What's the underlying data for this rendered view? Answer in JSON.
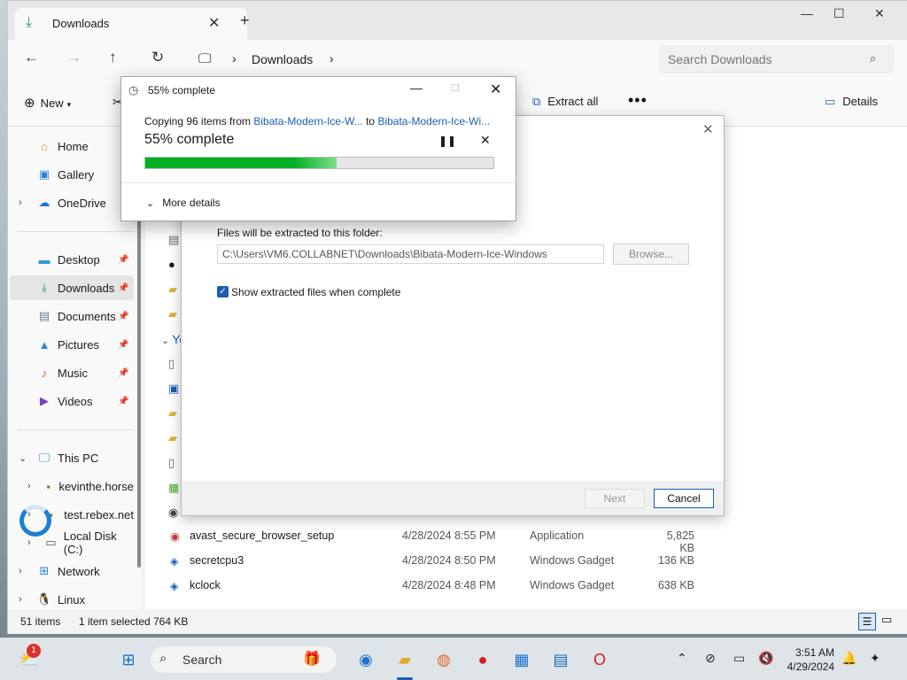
{
  "explorer": {
    "tab_title": "Downloads",
    "tab_close": "✕",
    "new_tab": "+",
    "minimize": "—",
    "maximize": "☐",
    "close": "✕",
    "address": {
      "location": "Downloads"
    },
    "search": {
      "placeholder": "Search Downloads"
    },
    "toolbar": {
      "new_label": "New",
      "extract_label": "Extract all",
      "more_label": "•••",
      "details_label": "Details"
    },
    "nav": [
      {
        "label": "Home",
        "icon": "home-icon",
        "pinned": false
      },
      {
        "label": "Gallery",
        "icon": "gallery-icon",
        "pinned": false
      },
      {
        "label": "OneDrive",
        "icon": "cloud-icon",
        "pinned": false
      },
      {
        "label": "Desktop",
        "icon": "desktop-icon",
        "pinned": true
      },
      {
        "label": "Downloads",
        "icon": "download-icon",
        "pinned": true
      },
      {
        "label": "Documents",
        "icon": "documents-icon",
        "pinned": true
      },
      {
        "label": "Pictures",
        "icon": "pictures-icon",
        "pinned": true
      },
      {
        "label": "Music",
        "icon": "music-icon",
        "pinned": true
      },
      {
        "label": "Videos",
        "icon": "videos-icon",
        "pinned": true
      },
      {
        "label": "This PC",
        "icon": "pc-icon",
        "pinned": false
      },
      {
        "label": "kevinthe.horse",
        "icon": "network-drive-icon",
        "pinned": false
      },
      {
        "label": "test.rebex.net",
        "icon": "network-drive-icon",
        "pinned": false
      },
      {
        "label": "Local Disk (C:)",
        "icon": "disk-icon",
        "pinned": false
      },
      {
        "label": "Network",
        "icon": "network-icon",
        "pinned": false
      },
      {
        "label": "Linux",
        "icon": "linux-icon",
        "pinned": false
      }
    ],
    "group_label": "Yes",
    "files": [
      {
        "name": "avast_secure_browser_setup",
        "date": "4/28/2024 8:55 PM",
        "type": "Application",
        "size": "5,825 KB"
      },
      {
        "name": "secretcpu3",
        "date": "4/28/2024 8:50 PM",
        "type": "Windows Gadget",
        "size": "136 KB"
      },
      {
        "name": "kclock",
        "date": "4/28/2024 8:48 PM",
        "type": "Windows Gadget",
        "size": "638 KB"
      }
    ],
    "status": {
      "count": "51 items",
      "selected": "1 item selected",
      "size": "764 KB"
    }
  },
  "wizard": {
    "close": "✕",
    "folder_label": "Files will be extracted to this folder:",
    "path_value": "C:\\Users\\VM6.COLLABNET\\Downloads\\Bibata-Modern-Ice-Windows",
    "browse_label": "Browse...",
    "show_files_label": "Show extracted files when complete",
    "show_files_checked": true,
    "next_label": "Next",
    "cancel_label": "Cancel"
  },
  "progress": {
    "title": "55% complete",
    "copying_prefix": "Copying 96 items from ",
    "from_link": "Bibata-Modern-Ice-W...",
    "to_word": " to ",
    "to_link": "Bibata-Modern-Ice-Wi...",
    "big_label": "55% complete",
    "percent": 55,
    "more_details": "More details",
    "minimize": "—",
    "maximize": "☐",
    "close": "✕",
    "pause": "❚❚",
    "cancel": "✕"
  },
  "taskbar": {
    "search_label": "Search",
    "notification_badge": "1",
    "time": "3:51 AM",
    "date": "4/29/2024"
  },
  "colors": {
    "accent": "#1a5fb4",
    "progress_green": "#06b025",
    "link": "#1a5fb4"
  }
}
